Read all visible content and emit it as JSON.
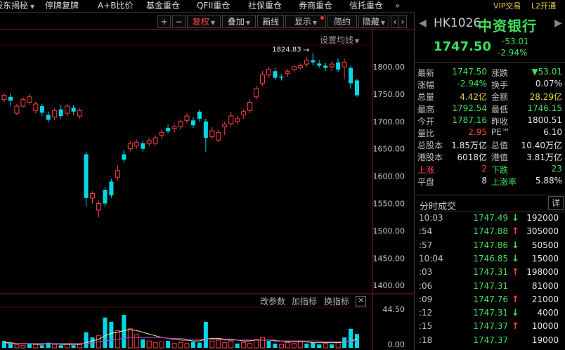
{
  "menu": [
    {
      "label": "股东揭秘",
      "caret": true
    },
    {
      "label": "停牌复牌"
    },
    {
      "label": "A+B比价"
    },
    {
      "label": "基金重仓"
    },
    {
      "label": "QFII重仓"
    },
    {
      "label": "社保重仓"
    },
    {
      "label": "券商重仓"
    },
    {
      "label": "信托重仓"
    },
    {
      "label": "»"
    }
  ],
  "menu_right": {
    "vip": "VIP交易",
    "l2": "L2开通"
  },
  "toolbar": {
    "plus": "+",
    "minus": "−",
    "adjust": "复权",
    "overlay": "叠加",
    "draw": "画线",
    "display": "显示",
    "simple": "简约",
    "hide": "隐藏",
    "prev": "‹",
    "next": "›",
    "set_ma": "设置均线"
  },
  "indicator_bar": {
    "params": "改参数",
    "add": "加指标",
    "switch": "换指标",
    "close": "✕"
  },
  "stock": {
    "code": "HK1026",
    "name": "中资银行",
    "price": "1747.50",
    "change": "-53.01",
    "change_pct": "-2.94%",
    "quote": [
      {
        "label": "最新",
        "value": "1747.50",
        "vc": "green",
        "label2": "涨跌",
        "value2": "▼53.01",
        "vc2": "green"
      },
      {
        "label": "涨幅",
        "value": "-2.94%",
        "vc": "green",
        "label2": "换手",
        "value2": "0.07%",
        "vc2": "white"
      },
      {
        "label": "总量",
        "value": "4.42亿",
        "vc": "yellow",
        "label2": "金额",
        "value2": "28.29亿",
        "vc2": "yellow"
      },
      {
        "label": "最高",
        "value": "1792.54",
        "vc": "green",
        "label2": "最低",
        "value2": "1746.15",
        "vc2": "green"
      },
      {
        "label": "今开",
        "value": "1787.16",
        "vc": "green",
        "label2": "昨收",
        "value2": "1800.51",
        "vc2": "white"
      },
      {
        "label": "量比",
        "value": "2.95",
        "vc": "red",
        "label2": "PE™",
        "value2": "6.10",
        "vc2": "white"
      },
      {
        "label": "总股本",
        "value": "1.85万亿",
        "vc": "white",
        "label2": "总值",
        "value2": "10.40万亿",
        "vc2": "white"
      },
      {
        "label": "港股本",
        "value": "6018亿",
        "vc": "white",
        "label2": "港值",
        "value2": "3.81万亿",
        "vc2": "white"
      },
      {
        "label": "上涨",
        "value": "2",
        "vc": "red",
        "label2": "下跌",
        "value2": "23",
        "vc2": "green",
        "lc": "red",
        "lc2": "green"
      },
      {
        "label": "平盘",
        "value": "8",
        "vc": "white",
        "label2": "上涨率",
        "value2": "5.88%",
        "vc2": "white",
        "lc2": "green"
      }
    ]
  },
  "trades": {
    "title": "分时成交",
    "detail": "详",
    "rows": [
      {
        "time": "10:03",
        "price": "1747.49",
        "dir": "down",
        "vol": "192000"
      },
      {
        "time": ":54",
        "price": "1747.88",
        "dir": "up",
        "vol": "305000"
      },
      {
        "time": ":57",
        "price": "1747.86",
        "dir": "down",
        "vol": "50500"
      },
      {
        "time": "10:04",
        "price": "1746.85",
        "dir": "down",
        "vol": "15000"
      },
      {
        "time": ":03",
        "price": "1747.31",
        "dir": "up",
        "vol": "198000"
      },
      {
        "time": ":06",
        "price": "1747.31",
        "dir": "none",
        "vol": "81000"
      },
      {
        "time": ":09",
        "price": "1747.76",
        "dir": "up",
        "vol": "21000"
      },
      {
        "time": ":12",
        "price": "1747.31",
        "dir": "down",
        "vol": "4000"
      },
      {
        "time": ":15",
        "price": "1747.37",
        "dir": "up",
        "vol": "10000"
      },
      {
        "time": ":18",
        "price": "1747.37",
        "dir": "none",
        "vol": "19000"
      }
    ]
  },
  "colors": {
    "up": "#ff4040",
    "down": "#00d8e8",
    "green": "#3fe05a",
    "ma1": "#e8e8a0",
    "ma2": "#d040d0"
  },
  "chart_data": {
    "type": "candlestick",
    "price_axis": [
      "1800.00",
      "1750.00",
      "1700.00",
      "1650.00",
      "1600.00",
      "1550.00",
      "1500.00",
      "1450.00",
      "1400.00"
    ],
    "ylim": [
      1390,
      1845
    ],
    "high_label": "1824.83",
    "high_arrow": "→",
    "volume_axis": [
      "44.50",
      "0.00"
    ],
    "volume_ylim": [
      0,
      44.5
    ],
    "candles": [
      [
        1740,
        1748,
        1735,
        1752
      ],
      [
        1745,
        1738,
        1728,
        1752
      ],
      [
        1715,
        1728,
        1712,
        1732
      ],
      [
        1728,
        1740,
        1725,
        1745
      ],
      [
        1735,
        1745,
        1730,
        1750
      ],
      [
        1720,
        1732,
        1715,
        1736
      ],
      [
        1728,
        1716,
        1710,
        1732
      ],
      [
        1712,
        1703,
        1698,
        1718
      ],
      [
        1708,
        1720,
        1702,
        1724
      ],
      [
        1722,
        1710,
        1705,
        1730
      ],
      [
        1715,
        1728,
        1710,
        1732
      ],
      [
        1725,
        1718,
        1712,
        1730
      ],
      [
        1710,
        1720,
        1705,
        1724
      ],
      [
        1640,
        1560,
        1545,
        1645
      ],
      [
        1560,
        1568,
        1550,
        1572
      ],
      [
        1538,
        1550,
        1525,
        1555
      ],
      [
        1575,
        1550,
        1545,
        1580
      ],
      [
        1590,
        1565,
        1560,
        1595
      ],
      [
        1598,
        1610,
        1592,
        1620
      ],
      [
        1640,
        1630,
        1625,
        1648
      ],
      [
        1650,
        1660,
        1645,
        1664
      ],
      [
        1655,
        1662,
        1650,
        1667
      ],
      [
        1660,
        1650,
        1645,
        1665
      ],
      [
        1660,
        1665,
        1655,
        1670
      ],
      [
        1660,
        1670,
        1656,
        1674
      ],
      [
        1675,
        1680,
        1668,
        1685
      ],
      [
        1688,
        1682,
        1678,
        1694
      ],
      [
        1687,
        1690,
        1680,
        1695
      ],
      [
        1690,
        1700,
        1685,
        1704
      ],
      [
        1702,
        1710,
        1697,
        1715
      ],
      [
        1702,
        1693,
        1688,
        1708
      ],
      [
        1718,
        1705,
        1700,
        1722
      ],
      [
        1700,
        1670,
        1645,
        1705
      ],
      [
        1672,
        1683,
        1668,
        1690
      ],
      [
        1666,
        1680,
        1662,
        1685
      ],
      [
        1690,
        1695,
        1675,
        1700
      ],
      [
        1696,
        1710,
        1690,
        1718
      ],
      [
        1700,
        1705,
        1696,
        1710
      ],
      [
        1712,
        1718,
        1705,
        1722
      ],
      [
        1720,
        1735,
        1715,
        1740
      ],
      [
        1745,
        1760,
        1740,
        1765
      ],
      [
        1770,
        1785,
        1765,
        1792
      ],
      [
        1785,
        1795,
        1780,
        1800
      ],
      [
        1792,
        1780,
        1776,
        1798
      ],
      [
        1782,
        1780,
        1775,
        1786
      ],
      [
        1788,
        1792,
        1782,
        1796
      ],
      [
        1795,
        1800,
        1790,
        1804
      ],
      [
        1798,
        1802,
        1794,
        1806
      ],
      [
        1805,
        1812,
        1800,
        1818
      ],
      [
        1812,
        1808,
        1802,
        1825
      ],
      [
        1806,
        1802,
        1798,
        1812
      ],
      [
        1802,
        1798,
        1792,
        1808
      ],
      [
        1800,
        1805,
        1792,
        1810
      ],
      [
        1808,
        1795,
        1790,
        1815
      ],
      [
        1800,
        1808,
        1778,
        1815
      ],
      [
        1798,
        1770,
        1760,
        1802
      ],
      [
        1775,
        1748,
        1745,
        1778
      ]
    ],
    "volumes": [
      [
        8,
        "down"
      ],
      [
        6,
        "down"
      ],
      [
        4,
        "up"
      ],
      [
        3,
        "up"
      ],
      [
        5,
        "down"
      ],
      [
        4,
        "up"
      ],
      [
        3,
        "down"
      ],
      [
        6,
        "down"
      ],
      [
        4,
        "up"
      ],
      [
        3,
        "down"
      ],
      [
        5,
        "up"
      ],
      [
        3,
        "down"
      ],
      [
        4,
        "up"
      ],
      [
        18,
        "down"
      ],
      [
        12,
        "down"
      ],
      [
        14,
        "up"
      ],
      [
        35,
        "down"
      ],
      [
        30,
        "down"
      ],
      [
        20,
        "up"
      ],
      [
        38,
        "down"
      ],
      [
        22,
        "up"
      ],
      [
        15,
        "up"
      ],
      [
        10,
        "down"
      ],
      [
        8,
        "up"
      ],
      [
        6,
        "up"
      ],
      [
        7,
        "up"
      ],
      [
        8,
        "down"
      ],
      [
        5,
        "up"
      ],
      [
        6,
        "up"
      ],
      [
        5,
        "up"
      ],
      [
        7,
        "down"
      ],
      [
        6,
        "down"
      ],
      [
        30,
        "down"
      ],
      [
        8,
        "up"
      ],
      [
        9,
        "up"
      ],
      [
        6,
        "up"
      ],
      [
        8,
        "up"
      ],
      [
        5,
        "down"
      ],
      [
        6,
        "up"
      ],
      [
        5,
        "up"
      ],
      [
        10,
        "up"
      ],
      [
        12,
        "up"
      ],
      [
        8,
        "down"
      ],
      [
        5,
        "down"
      ],
      [
        4,
        "up"
      ],
      [
        6,
        "up"
      ],
      [
        5,
        "up"
      ],
      [
        8,
        "up"
      ],
      [
        5,
        "down"
      ],
      [
        6,
        "down"
      ],
      [
        4,
        "down"
      ],
      [
        5,
        "up"
      ],
      [
        4,
        "down"
      ],
      [
        6,
        "up"
      ],
      [
        12,
        "down"
      ],
      [
        22,
        "down"
      ],
      [
        16,
        "down"
      ]
    ],
    "ma_price": [
      1745,
      1742,
      1738,
      1736,
      1733,
      1730,
      1728,
      1725,
      1722,
      1720
    ],
    "ma_vol_a": [
      6,
      6,
      5,
      5,
      5,
      4,
      4,
      5,
      5,
      4,
      4,
      4,
      4,
      6,
      8,
      10,
      14,
      17,
      18,
      20,
      21,
      20,
      18,
      16,
      14,
      12,
      11,
      10,
      9,
      9,
      8,
      8,
      10,
      11,
      11,
      10,
      10,
      9,
      8,
      8,
      9,
      9,
      9,
      8,
      8,
      7,
      7,
      7,
      7,
      6,
      6,
      6,
      6,
      6,
      7,
      8,
      10
    ],
    "ma_vol_b": [
      5,
      5,
      5,
      5,
      5,
      5,
      5,
      5,
      5,
      5,
      5,
      5,
      5,
      5,
      6,
      7,
      8,
      9,
      10,
      11,
      12,
      12,
      12,
      12,
      12,
      12,
      11,
      11,
      11,
      10,
      10,
      10,
      10,
      10,
      10,
      9,
      9,
      9,
      9,
      9,
      9,
      9,
      9,
      9,
      8,
      8,
      8,
      8,
      8,
      8,
      8,
      7,
      7,
      7,
      7,
      8,
      8
    ]
  }
}
